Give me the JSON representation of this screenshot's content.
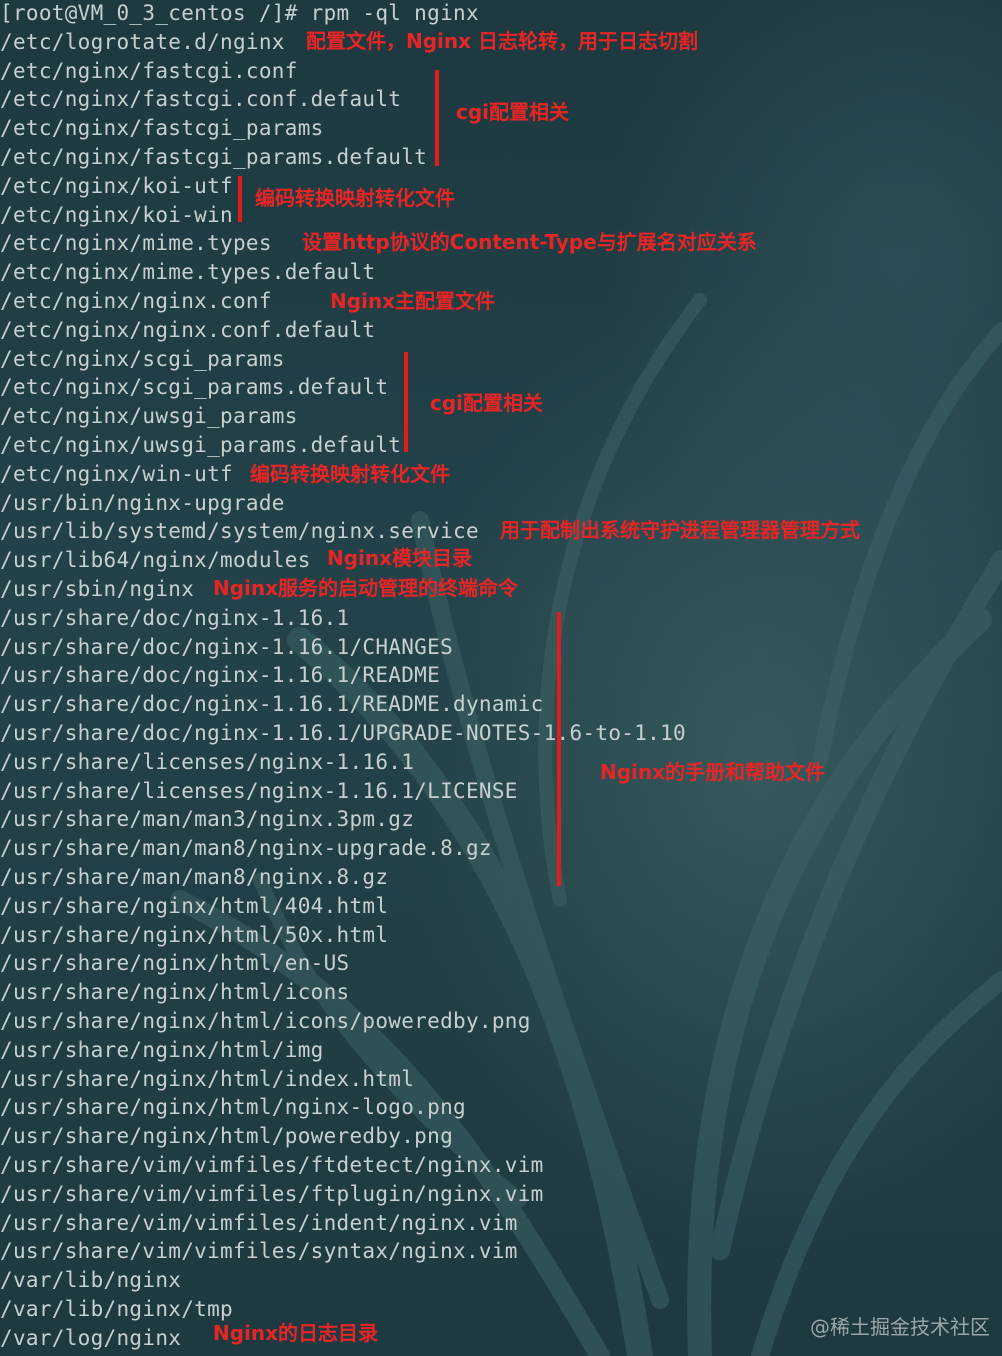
{
  "terminal": {
    "prompt_line": "[root@VM_0_3_centos /]# rpm -ql nginx",
    "files": [
      "/etc/logrotate.d/nginx",
      "/etc/nginx/fastcgi.conf",
      "/etc/nginx/fastcgi.conf.default",
      "/etc/nginx/fastcgi_params",
      "/etc/nginx/fastcgi_params.default",
      "/etc/nginx/koi-utf",
      "/etc/nginx/koi-win",
      "/etc/nginx/mime.types",
      "/etc/nginx/mime.types.default",
      "/etc/nginx/nginx.conf",
      "/etc/nginx/nginx.conf.default",
      "/etc/nginx/scgi_params",
      "/etc/nginx/scgi_params.default",
      "/etc/nginx/uwsgi_params",
      "/etc/nginx/uwsgi_params.default",
      "/etc/nginx/win-utf",
      "/usr/bin/nginx-upgrade",
      "/usr/lib/systemd/system/nginx.service",
      "/usr/lib64/nginx/modules",
      "/usr/sbin/nginx",
      "/usr/share/doc/nginx-1.16.1",
      "/usr/share/doc/nginx-1.16.1/CHANGES",
      "/usr/share/doc/nginx-1.16.1/README",
      "/usr/share/doc/nginx-1.16.1/README.dynamic",
      "/usr/share/doc/nginx-1.16.1/UPGRADE-NOTES-1.6-to-1.10",
      "/usr/share/licenses/nginx-1.16.1",
      "/usr/share/licenses/nginx-1.16.1/LICENSE",
      "/usr/share/man/man3/nginx.3pm.gz",
      "/usr/share/man/man8/nginx-upgrade.8.gz",
      "/usr/share/man/man8/nginx.8.gz",
      "/usr/share/nginx/html/404.html",
      "/usr/share/nginx/html/50x.html",
      "/usr/share/nginx/html/en-US",
      "/usr/share/nginx/html/icons",
      "/usr/share/nginx/html/icons/poweredby.png",
      "/usr/share/nginx/html/img",
      "/usr/share/nginx/html/index.html",
      "/usr/share/nginx/html/nginx-logo.png",
      "/usr/share/nginx/html/poweredby.png",
      "/usr/share/vim/vimfiles/ftdetect/nginx.vim",
      "/usr/share/vim/vimfiles/ftplugin/nginx.vim",
      "/usr/share/vim/vimfiles/indent/nginx.vim",
      "/usr/share/vim/vimfiles/syntax/nginx.vim",
      "/var/lib/nginx",
      "/var/lib/nginx/tmp",
      "/var/log/nginx"
    ]
  },
  "annotations": {
    "logrotate": "配置文件，Nginx 日志轮转，用于日志切割",
    "cgi_fastcgi": "cgi配置相关",
    "koi_encoding": "编码转换映射转化文件",
    "mime_types": "设置http协议的Content-Type与扩展名对应关系",
    "main_config": "Nginx主配置文件",
    "cgi_scgi_uwsgi": "cgi配置相关",
    "win_encoding": "编码转换映射转化文件",
    "systemd_service": "用于配制出系统守护进程管理器管理方式",
    "modules_dir": "Nginx模块目录",
    "sbin_command": "Nginx服务的启动管理的终端命令",
    "docs": "Nginx的手册和帮助文件",
    "log_dir": "Nginx的日志目录"
  },
  "watermark": "@稀土掘金技术社区",
  "colors": {
    "terminal_background": "#1f3a41",
    "terminal_text": "#c6d0d0",
    "annotation_red": "#e82525"
  }
}
